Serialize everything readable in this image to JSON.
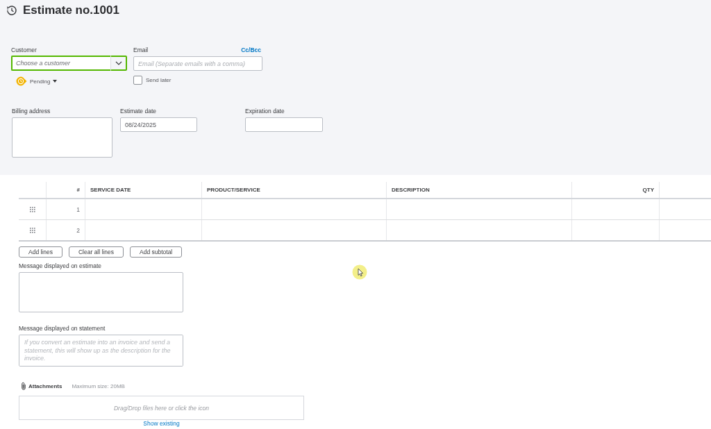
{
  "header": {
    "title": "Estimate no.1001"
  },
  "customer": {
    "label": "Customer",
    "placeholder": "Choose a customer",
    "focused": true
  },
  "status": {
    "label": "Pending"
  },
  "email": {
    "label": "Email",
    "cc_bcc": "Cc/Bcc",
    "placeholder": "Email (Separate emails with a comma)"
  },
  "send_later": {
    "label": "Send later",
    "checked": false
  },
  "billing_address": {
    "label": "Billing address"
  },
  "estimate_date": {
    "label": "Estimate date",
    "value": "08/24/2025"
  },
  "expiration_date": {
    "label": "Expiration date"
  },
  "table": {
    "columns": [
      {
        "label": "#",
        "kind": "numeric"
      },
      {
        "label": "SERVICE DATE",
        "kind": "text"
      },
      {
        "label": "PRODUCT/SERVICE",
        "kind": "text"
      },
      {
        "label": "DESCRIPTION",
        "kind": "text"
      },
      {
        "label": "QTY",
        "kind": "numeric"
      }
    ],
    "rows": [
      {
        "number": "1"
      },
      {
        "number": "2"
      }
    ]
  },
  "line_buttons": [
    "Add lines",
    "Clear all lines",
    "Add subtotal"
  ],
  "estimate_message": {
    "label": "Message displayed on estimate"
  },
  "statement_message": {
    "label": "Message displayed on statement",
    "placeholder": "If you convert an estimate into an invoice and send a statement, this will show up as the description for the invoice."
  },
  "attachments": {
    "label": "Attachments",
    "max_size": "Maximum size: 20MB",
    "drop_hint": "Drag/Drop files here or click the icon",
    "show_existing": "Show existing"
  }
}
